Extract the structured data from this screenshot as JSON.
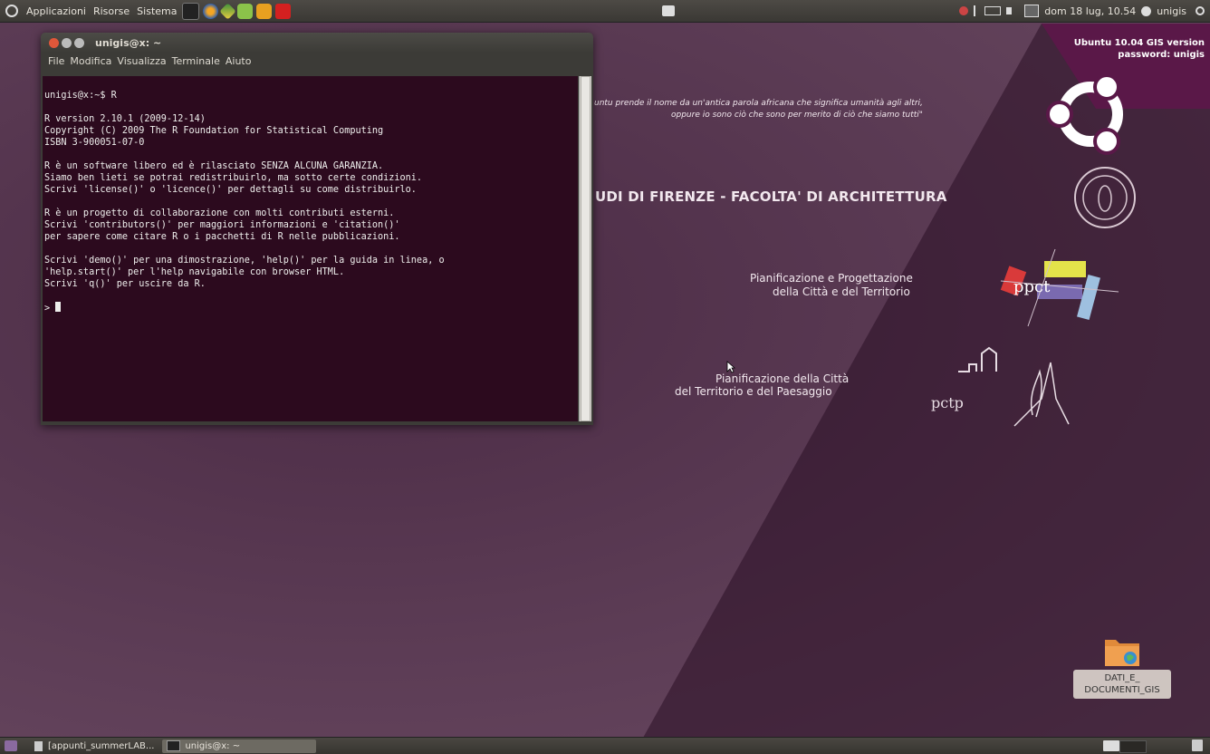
{
  "top_panel": {
    "menus": [
      "Applicazioni",
      "Risorse",
      "Sistema"
    ],
    "clock": "dom 18 lug, 10.54",
    "user": "unigis"
  },
  "terminal": {
    "title": "unigis@x: ~",
    "menus": [
      "File",
      "Modifica",
      "Visualizza",
      "Terminale",
      "Aiuto"
    ],
    "lines": [
      "unigis@x:~$ R",
      "",
      "R version 2.10.1 (2009-12-14)",
      "Copyright (C) 2009 The R Foundation for Statistical Computing",
      "ISBN 3-900051-07-0",
      "",
      "R è un software libero ed è rilasciato SENZA ALCUNA GARANZIA.",
      "Siamo ben lieti se potrai redistribuirlo, ma sotto certe condizioni.",
      "Scrivi 'license()' o 'licence()' per dettagli su come distribuirlo.",
      "",
      "R è un progetto di collaborazione con molti contributi esterni.",
      "Scrivi 'contributors()' per maggiori informazioni e 'citation()'",
      "per sapere come citare R o i pacchetti di R nelle pubblicazioni.",
      "",
      "Scrivi 'demo()' per una dimostrazione, 'help()' per la guida in linea, o",
      "'help.start()' per l'help navigabile con browser HTML.",
      "Scrivi 'q()' per uscire da R.",
      ""
    ],
    "prompt": "> "
  },
  "wallpaper": {
    "quote_line1": "untu prende il nome da un'antica parola africana che significa umanità agli altri,",
    "quote_line2": "oppure io sono ciò che sono per merito di ciò che siamo tutti\"",
    "faculty": "UDI DI FIRENZE - FACOLTA' DI ARCHITETTURA",
    "ppct_line1": "Pianificazione e Progettazione",
    "ppct_line2": "della Città e del Territorio",
    "ppct_logo": "ppct",
    "pctp_line1": "Pianificazione della Città",
    "pctp_line2": "del Territorio e del Paesaggio",
    "pctp_logo": "pctp",
    "ubuntu_version": "Ubuntu 10.04 GIS version",
    "ubuntu_password": "password: unigis"
  },
  "desktop_folder": {
    "label_line1": "DATI_E_",
    "label_line2": "DOCUMENTI_GIS"
  },
  "bottom_panel": {
    "tasks": [
      "[appunti_summerLAB...",
      "unigis@x: ~"
    ]
  },
  "colors": {
    "terminal_bg": "#2c0a1e",
    "wallpaper": "#5a3a52",
    "ubuntu_orange": "#dd4814"
  }
}
